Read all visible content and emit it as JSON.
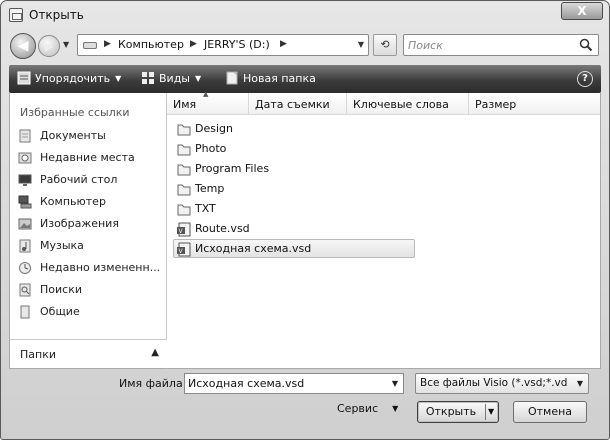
{
  "window": {
    "title": "Открыть",
    "close_label": "X"
  },
  "nav": {
    "back_label": "◀",
    "forward_label": "▶",
    "address": {
      "crumbs": [
        "Компьютер",
        "JERRY'S (D:)"
      ]
    },
    "search_placeholder": "Поиск"
  },
  "toolbar": {
    "organize_label": "Упорядочить",
    "views_label": "Виды",
    "new_folder_label": "Новая папка",
    "help_label": "?"
  },
  "sidebar": {
    "favorites_title": "Избранные ссылки",
    "items": [
      {
        "label": "Документы",
        "icon": "documents-icon"
      },
      {
        "label": "Недавние места",
        "icon": "recent-places-icon"
      },
      {
        "label": "Рабочий стол",
        "icon": "desktop-icon"
      },
      {
        "label": "Компьютер",
        "icon": "computer-icon"
      },
      {
        "label": "Изображения",
        "icon": "pictures-icon"
      },
      {
        "label": "Музыка",
        "icon": "music-icon"
      },
      {
        "label": "Недавно измененн...",
        "icon": "recently-changed-icon"
      },
      {
        "label": "Поиски",
        "icon": "searches-icon"
      },
      {
        "label": "Общие",
        "icon": "public-icon"
      }
    ],
    "folders_label": "Папки"
  },
  "columns": [
    "Имя",
    "Дата съемки",
    "Ключевые слова",
    "Размер"
  ],
  "files": [
    {
      "name": "Design",
      "type": "folder"
    },
    {
      "name": "Photo",
      "type": "folder"
    },
    {
      "name": "Program Files",
      "type": "folder"
    },
    {
      "name": "Temp",
      "type": "folder"
    },
    {
      "name": "TXT",
      "type": "folder"
    },
    {
      "name": "Route.vsd",
      "type": "visio"
    },
    {
      "name": "Исходная схема.vsd",
      "type": "visio",
      "selected": true
    }
  ],
  "footer": {
    "filename_label": "Имя файла:",
    "filename_value": "Исходная схема.vsd",
    "filetype_value": "Все файлы Visio (*.vsd;*.vdx;*.",
    "service_label": "Сервис",
    "open_label": "Открыть",
    "cancel_label": "Отмена"
  }
}
